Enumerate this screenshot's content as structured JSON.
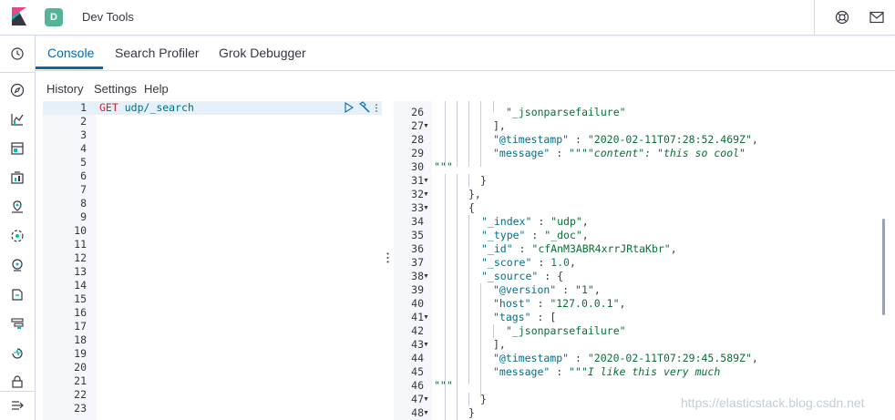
{
  "header": {
    "app_title": "Dev Tools",
    "space_initial": "D",
    "icons": [
      "kibana-logo-icon",
      "help-icon",
      "mail-icon"
    ]
  },
  "sidenav": {
    "icons": [
      "clock-icon",
      "compass-icon",
      "visualize-icon",
      "dashboard-icon",
      "canvas-icon",
      "maps-icon",
      "ml-icon",
      "infrastructure-icon",
      "logs-icon",
      "apm-icon",
      "uptime-icon",
      "siem-icon",
      "collapse-icon"
    ]
  },
  "tabs": {
    "console": "Console",
    "search_profiler": "Search Profiler",
    "grok_debugger": "Grok Debugger"
  },
  "menu": {
    "history": "History",
    "settings": "Settings",
    "help": "Help"
  },
  "editor": {
    "line_numbers": [
      "1",
      "2",
      "3",
      "4",
      "5",
      "6",
      "7",
      "8",
      "9",
      "10",
      "11",
      "12",
      "13",
      "14",
      "15",
      "16",
      "17",
      "18",
      "19",
      "20",
      "21",
      "22",
      "23"
    ],
    "method": "GET",
    "url": "udp/_search"
  },
  "output": {
    "line_numbers": [
      "26",
      "27",
      "28",
      "29",
      "30",
      "31",
      "32",
      "33",
      "34",
      "35",
      "36",
      "37",
      "38",
      "39",
      "40",
      "41",
      "42",
      "43",
      "44",
      "45",
      "46",
      "47",
      "48"
    ],
    "l26": "\"_jsonparsefailure\"",
    "l27": "],",
    "l28_key": "\"@timestamp\"",
    "l28_val": "\"2020-02-11T07:28:52.469Z\"",
    "l29_key": "\"message\"",
    "l29_q": "\"\"\"",
    "l29_val": "\"content\": \"this so cool\"",
    "l30": "\"\"\"",
    "l31": "}",
    "l32": "},",
    "l33": "{",
    "l34_key": "\"_index\"",
    "l34_val": "\"udp\"",
    "l35_key": "\"_type\"",
    "l35_val": "\"_doc\"",
    "l36_key": "\"_id\"",
    "l36_val": "\"cfAnM3ABR4xrrJRtaKbr\"",
    "l37_key": "\"_score\"",
    "l37_val": "1.0",
    "l38_key": "\"_source\"",
    "l39_key": "\"@version\"",
    "l39_val": "\"1\"",
    "l40_key": "\"host\"",
    "l40_val": "\"127.0.0.1\"",
    "l41_key": "\"tags\"",
    "l42": "\"_jsonparsefailure\"",
    "l43": "],",
    "l44_key": "\"@timestamp\"",
    "l44_val": "\"2020-02-11T07:29:45.589Z\"",
    "l45_key": "\"message\"",
    "l45_q": "\"\"\"",
    "l45_val": "I like this very much",
    "l46": "\"\"\"",
    "l47": "}",
    "l48": "}"
  },
  "watermark": "https://elasticstack.blog.csdn.net"
}
